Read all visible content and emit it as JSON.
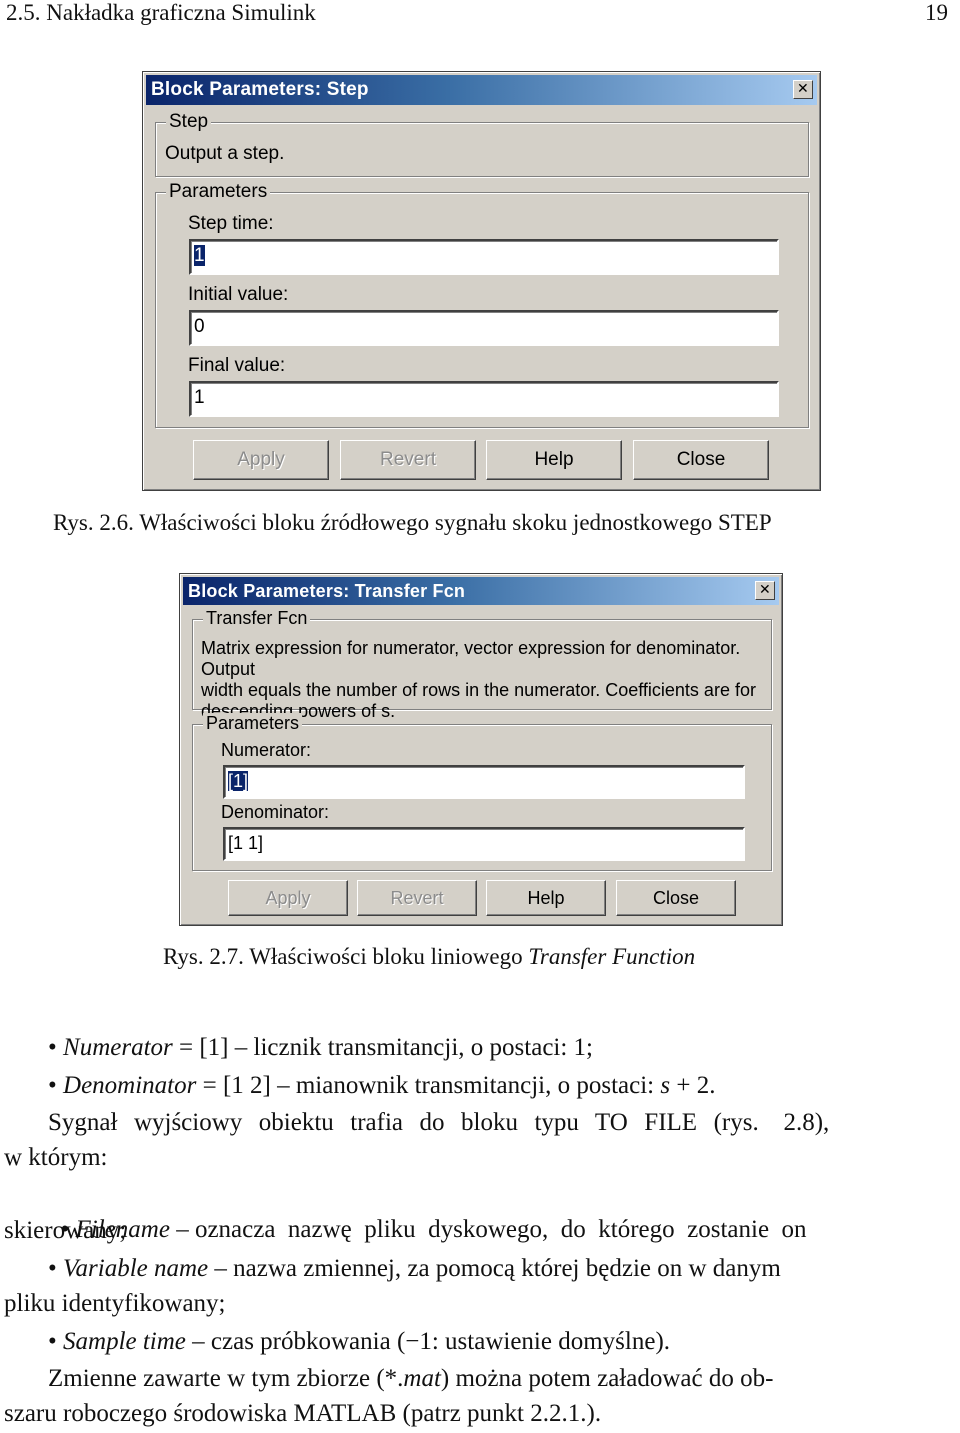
{
  "page": {
    "section_header": "2.5.  Nakładka graficzna Simulink",
    "page_number": "19"
  },
  "dialog_step": {
    "title": "Block Parameters: Step",
    "close_icon": "close-icon",
    "info_group": {
      "legend": "Step",
      "description": "Output a step."
    },
    "params_group": {
      "legend": "Parameters",
      "fields": [
        {
          "label": "Step time:",
          "value": "1",
          "selected": true
        },
        {
          "label": "Initial value:",
          "value": "0",
          "selected": false
        },
        {
          "label": "Final value:",
          "value": "1",
          "selected": false
        }
      ]
    },
    "buttons": {
      "apply": "Apply",
      "revert": "Revert",
      "help": "Help",
      "close": "Close"
    },
    "caption": "Rys. 2.6.  Właściwości bloku źródłowego sygnału skoku jednostkowego STEP"
  },
  "dialog_tf": {
    "title": "Block Parameters: Transfer Fcn",
    "close_icon": "close-icon",
    "info_group": {
      "legend": "Transfer Fcn",
      "description_lines": [
        "Matrix expression for numerator, vector expression for denominator.  Output",
        "width equals the number of rows in the numerator.  Coefficients are for",
        "descending powers of s."
      ]
    },
    "params_group": {
      "legend": "Parameters",
      "fields": [
        {
          "label": "Numerator:",
          "value": "[1]",
          "selected": true
        },
        {
          "label": "Denominator:",
          "value": "[1 1]",
          "selected": false
        }
      ]
    },
    "buttons": {
      "apply": "Apply",
      "revert": "Revert",
      "help": "Help",
      "close": "Close"
    },
    "caption_prefix": "Rys. 2.7.  Właściwości bloku liniowego ",
    "caption_italic": "Transfer Function"
  },
  "body": {
    "bullet1_term": "Numerator",
    "bullet1_rest": " = [1] – licznik transmitancji, o postaci: 1;",
    "bullet2_term": "Denominator",
    "bullet2_rest": " = [1   2] – mianownik transmitancji, o postaci: ",
    "bullet2_math": "s",
    "bullet2_tail": " + 2.",
    "para1_line1": "Sygnał  wyjściowy  obiektu  trafia  do  bloku  typu  TO  FILE  (rys.   2.8),",
    "para1_line2": "w którym:",
    "bullet3_term": "Filename",
    "bullet3_rest": " – oznacza  nazwę  pliku  dyskowego,  do  którego  zostanie  on",
    "bullet3_line2": "skierowany;",
    "bullet4_term": "Variable name",
    "bullet4_rest": " – nazwa zmiennej, za pomocą której będzie on w danym",
    "bullet4_line2": "pliku identyfikowany;",
    "bullet5_term": "Sample time",
    "bullet5_rest": " – czas próbkowania (−1: ustawienie domyślne).",
    "para2_pre": "Zmienne zawarte w tym zbiorze (*.",
    "para2_italic": "mat",
    "para2_post": ") można potem załadować do ob-",
    "para2_line2": "szaru roboczego środowiska MATLAB (patrz punkt 2.2.1.).",
    "bullet_glyph": "•"
  }
}
